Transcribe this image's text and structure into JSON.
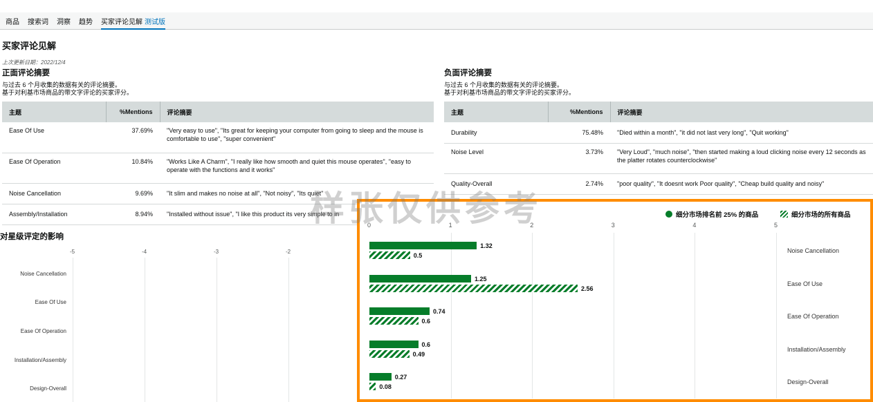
{
  "nav": {
    "tabs": [
      "商品",
      "搜索词",
      "洞察",
      "趋势",
      "买家评论见解"
    ],
    "beta": "测试版"
  },
  "page_title": "买家评论见解",
  "updated": "上次更新日期：2022/12/4",
  "positive": {
    "title": "正面评论摘要",
    "desc1": "与过去 6 个月收集的数据有关的评论摘要。",
    "desc2": "基于对利基市场商品的带文字评论的买家评分。",
    "headers": [
      "主题",
      "%Mentions",
      "评论摘要"
    ],
    "rows": [
      {
        "topic": "Ease Of Use",
        "pct": "37.69%",
        "summary": "\"Very easy to use\", \"Its great for keeping your computer from going to sleep and the mouse is comfortable to use\", \"super convenient\""
      },
      {
        "topic": "Ease Of Operation",
        "pct": "10.84%",
        "summary": "\"Works Like A Charm\", \"I really like how smooth and quiet this mouse operates\", \"easy to operate with the functions and it works\""
      },
      {
        "topic": "Noise Cancellation",
        "pct": "9.69%",
        "summary": "\"It slim and makes no noise at all\", \"Not noisy\", \"Its quiet\""
      },
      {
        "topic": "Assembly/Installation",
        "pct": "8.94%",
        "summary": "\"Installed without issue\", \"I like this product its very simple to in"
      }
    ]
  },
  "negative": {
    "title": "负面评论摘要",
    "desc1": "与过去 6 个月收集的数据有关的评论摘要。",
    "desc2": "基于对利基市场商品的带文字评论的买家评分。",
    "headers": [
      "主题",
      "%Mentions",
      "评论摘要"
    ],
    "rows": [
      {
        "topic": "Durability",
        "pct": "75.48%",
        "summary": "\"Died within a month\", \"it did not last very long\", \"Quit working\""
      },
      {
        "topic": "Noise Level",
        "pct": "3.73%",
        "summary": "\"Very Loud\", \"much noise\", \"then started making a loud clicking noise every 12 seconds as the platter rotates counterclockwise\""
      },
      {
        "topic": "Quality-Overall",
        "pct": "2.74%",
        "summary": "\"poor quality\", \"It doesnt work Poor quality\", \"Cheap build quality and noisy\""
      }
    ]
  },
  "watermark": "样张仅供参考",
  "star_chart": {
    "title": "对星级评定的影响",
    "ticks": [
      "-5",
      "-4",
      "-3",
      "-2"
    ],
    "categories": [
      "Noise Cancellation",
      "Ease Of Use",
      "Ease Of Operation",
      "Installation/Assembly",
      "Design-Overall"
    ]
  },
  "chart_data": {
    "type": "bar",
    "orientation": "horizontal",
    "x": [
      0,
      1,
      2,
      3,
      4,
      5
    ],
    "xlim": [
      0,
      5
    ],
    "categories": [
      "Noise Cancellation",
      "Ease Of Use",
      "Ease Of Operation",
      "Installation/Assembly",
      "Design-Overall"
    ],
    "series": [
      {
        "name": "细分市场排名前 25% 的商品",
        "style": "solid",
        "color": "#067d2a",
        "values": [
          1.32,
          1.25,
          0.74,
          0.6,
          0.27
        ]
      },
      {
        "name": "细分市场的所有商品",
        "style": "hatched",
        "color": "#067d2a",
        "values": [
          0.5,
          2.56,
          0.6,
          0.49,
          0.08
        ]
      }
    ],
    "legend_position": "top-right",
    "grid": true
  }
}
